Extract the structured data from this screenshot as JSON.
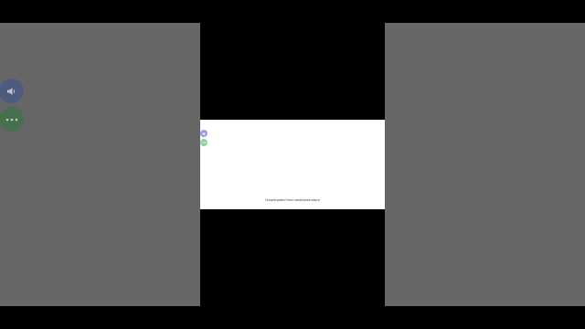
{
  "colors": {
    "background": "#000000",
    "backdrop": "#666666",
    "card": "#ffffff",
    "speaker_button": "#9b9ee6",
    "more_button": "#8fd19a",
    "ghost_speaker_button": "#4e5a7e",
    "ghost_more_button": "#47704f"
  },
  "icons": {
    "speaker": "speaker-icon",
    "more": "more-dots-icon"
  },
  "card": {
    "footer_text": "Downloaded from andrewsir.store"
  }
}
